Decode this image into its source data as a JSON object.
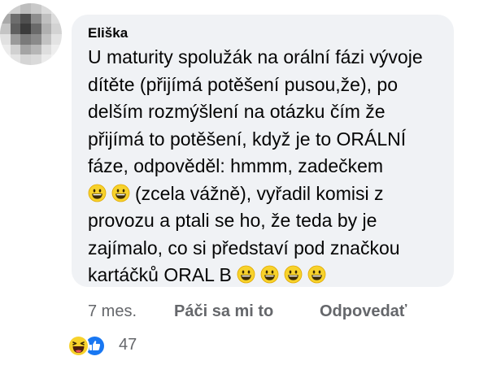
{
  "comment": {
    "author": "Eliška",
    "lines": [
      "U maturity spolužák na orální fázi vývoje",
      "dítěte (přijímá potěšení pusou,že), po",
      "delším rozmýšlení na otázku čím že",
      "přijímá to potěšení, když je to ORÁLNÍ",
      "fáze, odpověděl: hmmm, zadečkem"
    ],
    "line6_text": "(zcela vážně), vyřadil komisi z",
    "line7": "provozu a ptali se ho, že teda by je",
    "line8": "zajímalo, co si představí pod značkou",
    "line9_text": "kartáčků ORAL B",
    "emoji_name": "grinning-face-icon"
  },
  "actions": {
    "time": "7 mes.",
    "like_label": "Páči sa mi to",
    "reply_label": "Odpovedať"
  },
  "reactions": {
    "count": "47",
    "icons": [
      "haha-reaction-icon",
      "like-reaction-icon"
    ]
  },
  "colors": {
    "bubble": "#f0f2f5",
    "text": "#050505",
    "secondary": "#65676b",
    "like_blue": "#1877f2",
    "emoji_yellow": "#f7d22b"
  }
}
